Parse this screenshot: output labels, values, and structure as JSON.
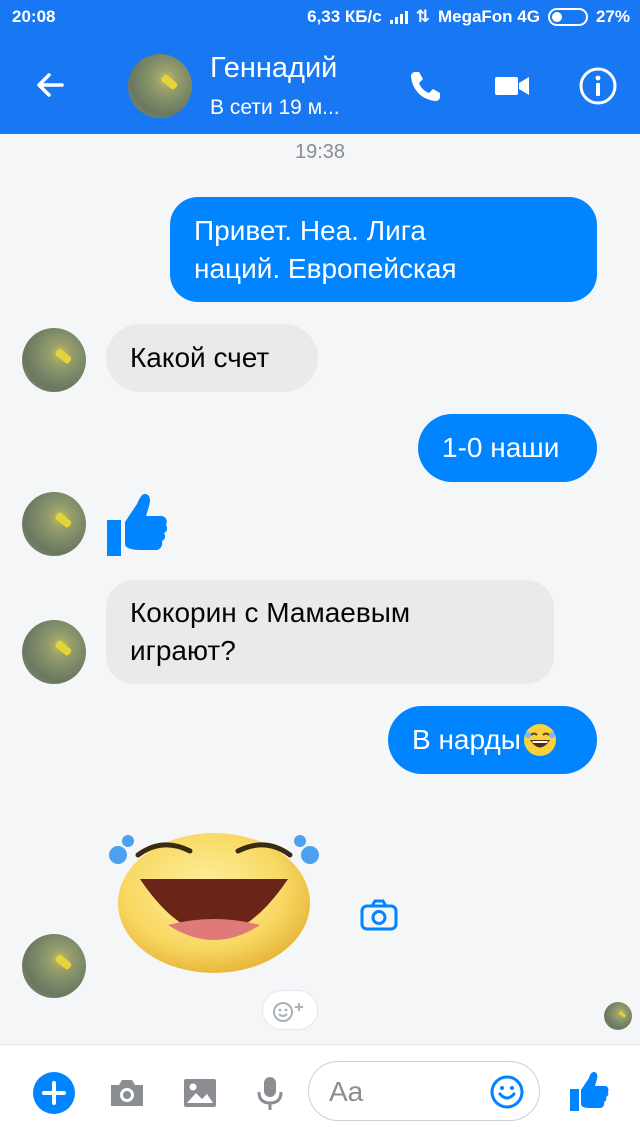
{
  "status_bar": {
    "time": "20:08",
    "speed": "6,33 КБ/с",
    "carrier": "MegaFon 4G",
    "battery": "27%"
  },
  "header": {
    "contact_name": "Геннадий",
    "contact_status": "В сети 19 м...",
    "icons": [
      "back-arrow-icon",
      "phone-icon",
      "video-camera-icon",
      "info-icon"
    ]
  },
  "conversation": {
    "timestamp": "19:38",
    "messages": [
      {
        "from": "me",
        "lines": [
          "Привет. Неа. Лига",
          "наций. Европейская"
        ]
      },
      {
        "from": "contact",
        "lines": [
          "Какой счет"
        ]
      },
      {
        "from": "me",
        "lines": [
          "1-0 наши"
        ]
      },
      {
        "from": "contact",
        "sticker": "thumbs-up"
      },
      {
        "from": "contact",
        "lines": [
          "Кокорин с Мамаевым",
          "играют?"
        ]
      },
      {
        "from": "me",
        "lines": [
          "В нарды"
        ],
        "emoji": "laughing-tears"
      },
      {
        "from": "contact",
        "sticker": "laughing-tears"
      }
    ]
  },
  "composer": {
    "placeholder": "Aa",
    "icons": [
      "plus-icon",
      "camera-icon",
      "gallery-icon",
      "microphone-icon",
      "emoji-icon",
      "like-icon"
    ]
  },
  "colors": {
    "brand_blue": "#1877f2",
    "outgoing_bubble": "#0084ff",
    "incoming_bubble": "#e9eaeb"
  }
}
